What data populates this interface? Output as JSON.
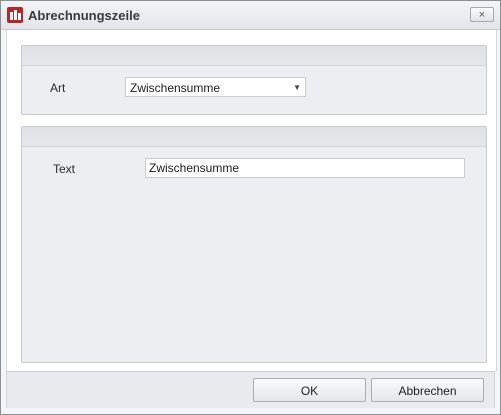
{
  "window": {
    "title": "Abrechnungszeile",
    "close_glyph": "×"
  },
  "group_type": {
    "label": "Art",
    "selected_value": "Zwischensumme",
    "dropdown_glyph": "▼"
  },
  "group_text": {
    "label": "Text",
    "value": "Zwischensumme"
  },
  "footer": {
    "ok_label": "OK",
    "cancel_label": "Abbrechen"
  },
  "icons": {
    "app": "app-logo-icon",
    "close": "close-icon",
    "dropdown": "chevron-down-icon"
  },
  "colors": {
    "app_icon": "#b8262b",
    "group_bg": "#edeef1"
  }
}
